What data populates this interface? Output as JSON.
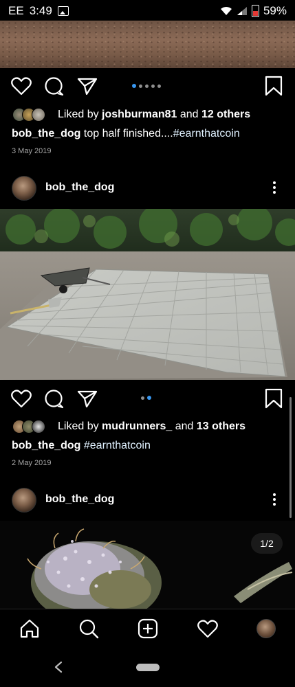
{
  "status_bar": {
    "carrier": "EE",
    "time": "3:49",
    "battery": "59%"
  },
  "post1": {
    "liked_prefix": "Liked by ",
    "liked_user": "joshburman81",
    "liked_and": " and ",
    "liked_others": "12 others",
    "caption_user": "bob_the_dog",
    "caption_text": " top half finished....",
    "caption_tag": "#earnthatcoin",
    "date": "3 May 2019",
    "carousel_count": 5,
    "carousel_active": 0
  },
  "post2": {
    "username": "bob_the_dog",
    "liked_prefix": "Liked by ",
    "liked_user": "mudrunners_",
    "liked_and": " and ",
    "liked_others": "13 others",
    "caption_user": "bob_the_dog",
    "caption_tag": " #earnthatcoin",
    "date": "2 May 2019",
    "carousel_count": 2,
    "carousel_active": 1
  },
  "post3": {
    "username": "bob_the_dog",
    "image_counter": "1/2"
  },
  "icons": {
    "like": "heart-icon",
    "comment": "comment-icon",
    "share": "send-icon",
    "save": "bookmark-icon",
    "home": "home-icon",
    "search": "search-icon",
    "new_post": "plus-square-icon",
    "activity": "heart-icon",
    "profile": "avatar",
    "back": "back-chevron-icon"
  },
  "colors": {
    "accent": "#3897f0",
    "background": "#000000",
    "battery": "#e53935"
  }
}
